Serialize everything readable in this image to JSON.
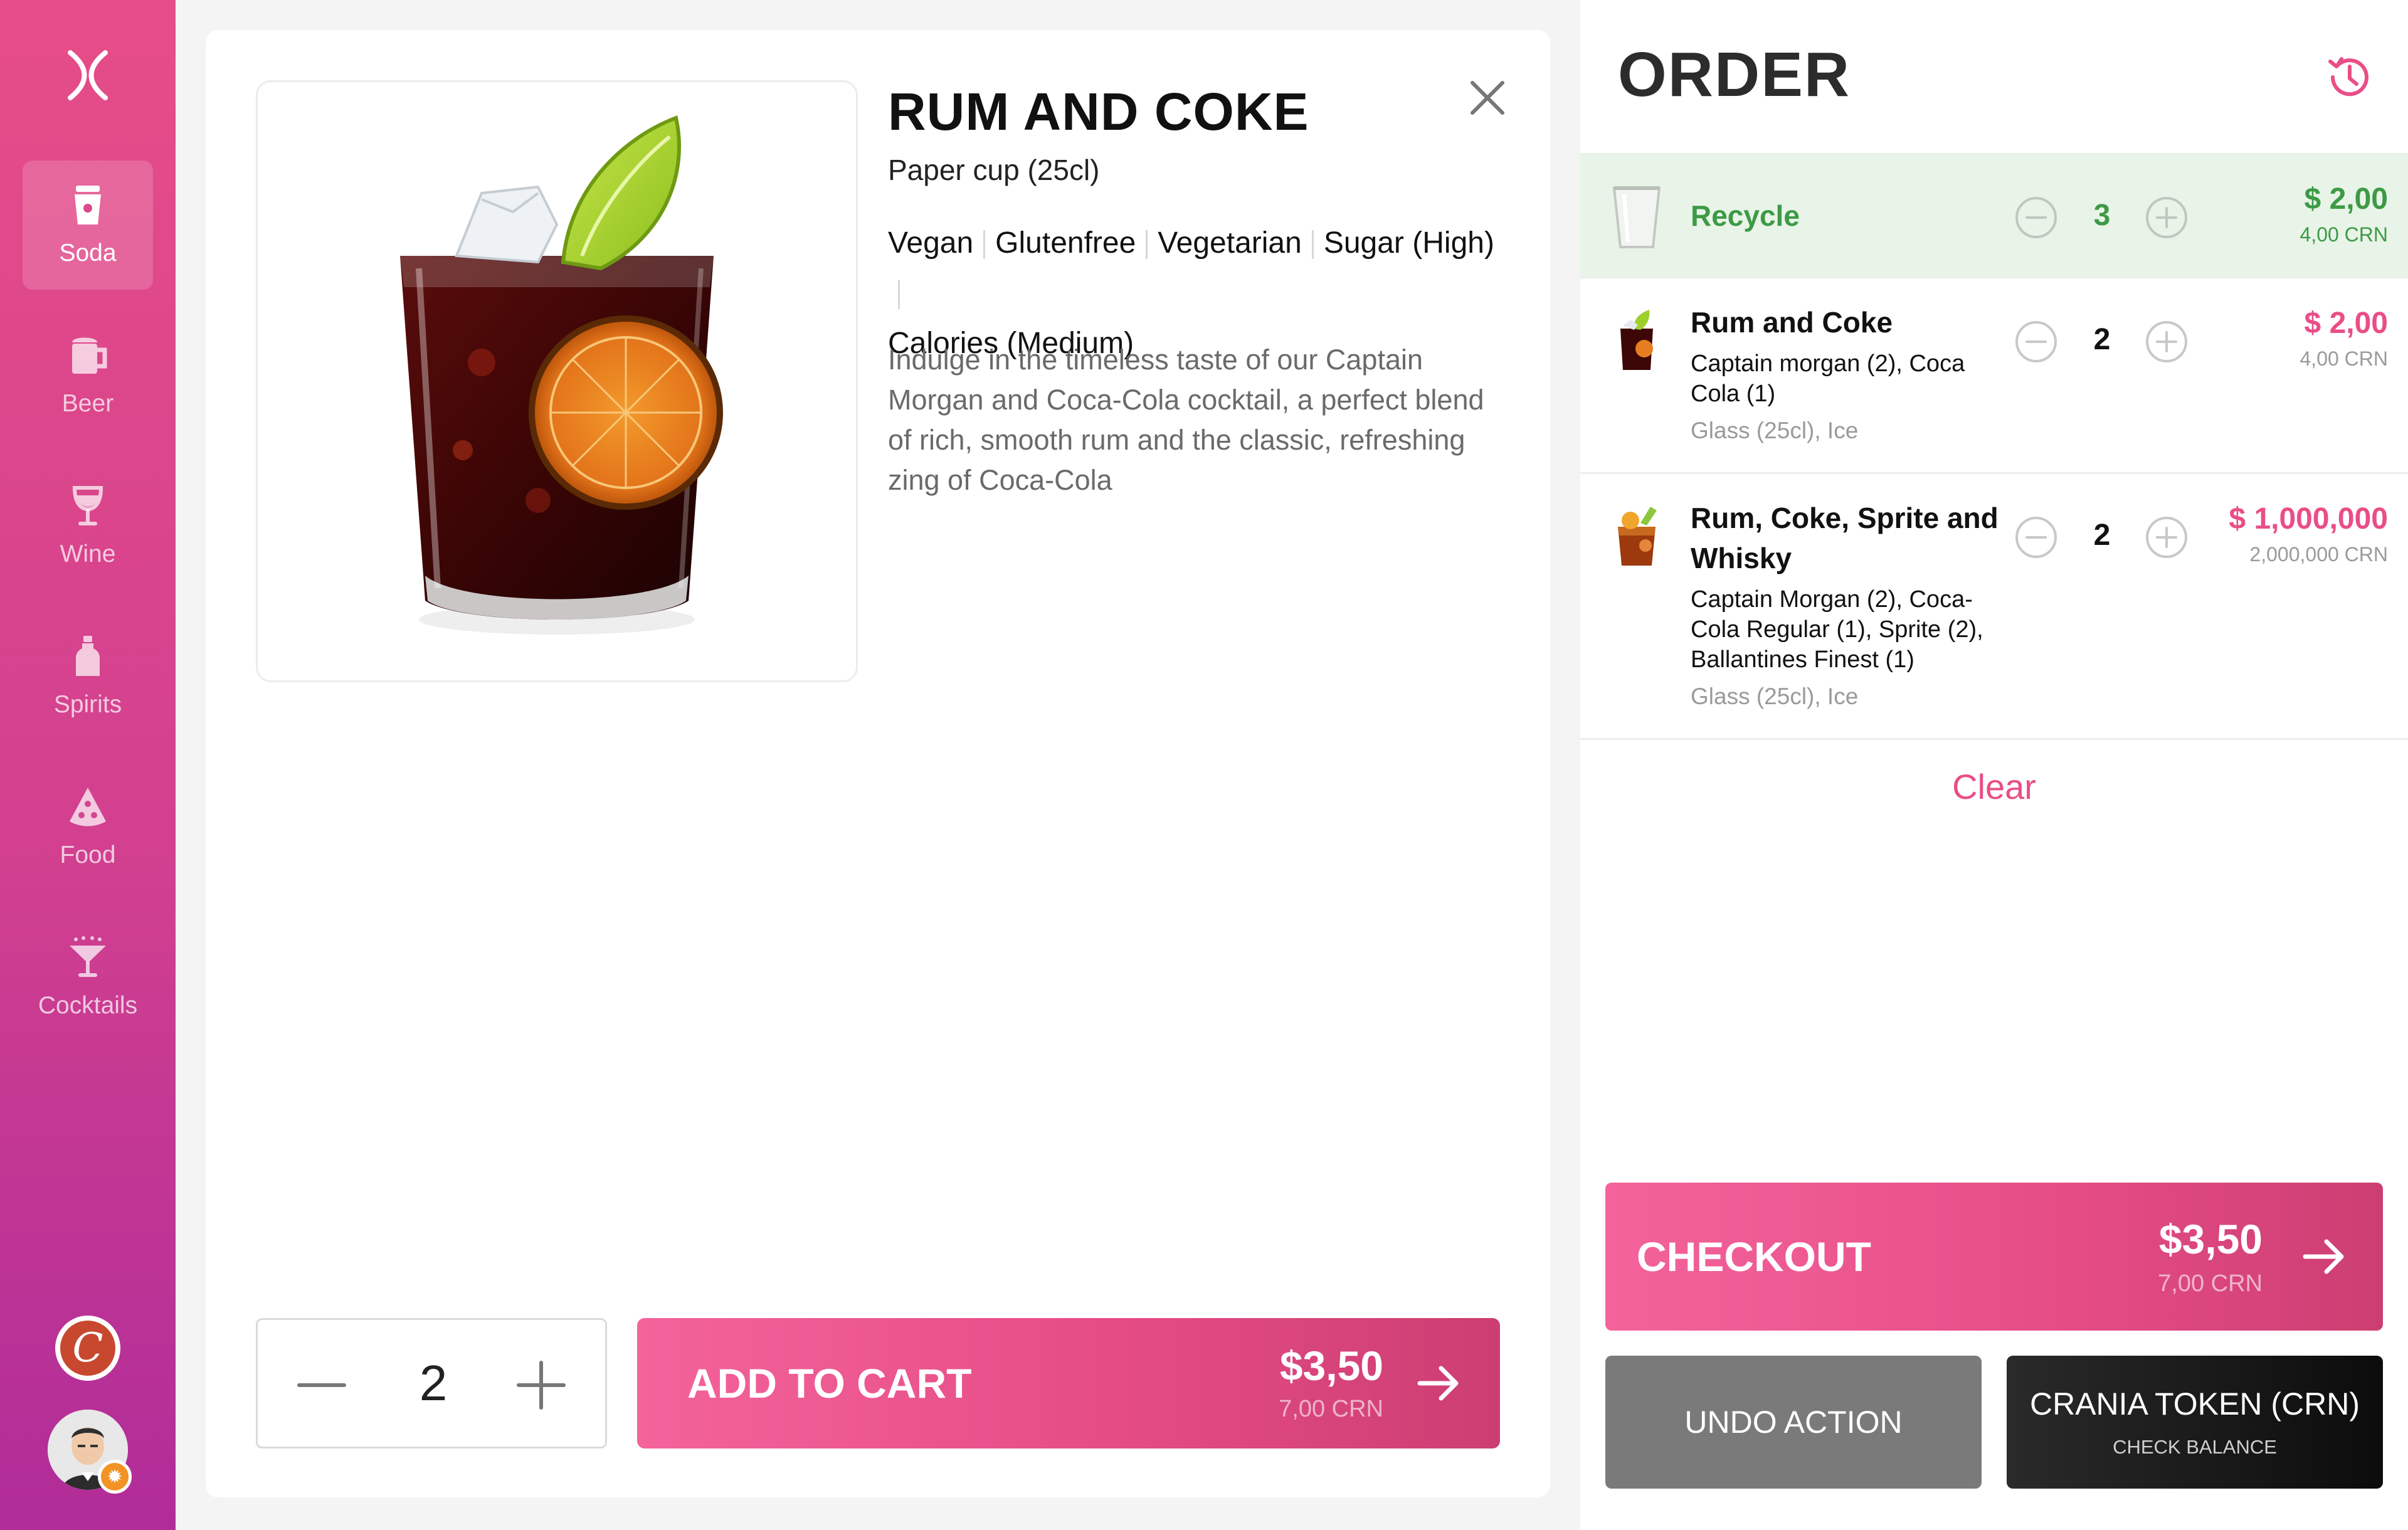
{
  "sidebar": {
    "logo": "x-logo-icon",
    "items": [
      {
        "label": "Soda",
        "icon": "soda-cup-icon",
        "active": true
      },
      {
        "label": "Beer",
        "icon": "beer-mug-icon",
        "active": false
      },
      {
        "label": "Wine",
        "icon": "wine-glass-icon",
        "active": false
      },
      {
        "label": "Spirits",
        "icon": "bottle-icon",
        "active": false
      },
      {
        "label": "Food",
        "icon": "pizza-slice-icon",
        "active": false
      },
      {
        "label": "Cocktails",
        "icon": "cocktail-glass-icon",
        "active": false
      }
    ],
    "brand_badge": "C",
    "accent": "#e64d88"
  },
  "product": {
    "title": "RUM AND COKE",
    "subtitle": "Paper cup (25cl)",
    "tags": [
      "Vegan",
      "Glutenfree",
      "Vegetarian",
      "Sugar (High)",
      "Calories (Medium)"
    ],
    "description": "Indulge in the timeless taste of our Captain Morgan and Coca-Cola cocktail, a perfect blend of rich, smooth rum and the classic, refreshing zing of Coca-Cola",
    "quantity": "2",
    "add_label": "ADD TO CART",
    "price": "$3,50",
    "price_crn": "7,00 CRN"
  },
  "order": {
    "title": "ORDER",
    "items": [
      {
        "name": "Recycle",
        "quantity": "3",
        "amount": "$ 2,00",
        "amount_crn": "4,00 CRN",
        "extras": "",
        "options": ""
      },
      {
        "name": "Rum and Coke",
        "quantity": "2",
        "amount": "$ 2,00",
        "amount_crn": "4,00 CRN",
        "extras": "Captain morgan (2), Coca Cola (1)",
        "options": "Glass (25cl), Ice"
      },
      {
        "name": "Rum, Coke, Sprite and Whisky",
        "quantity": "2",
        "amount": "$ 1,000,000",
        "amount_crn": "2,000,000 CRN",
        "extras": "Captain Morgan (2), Coca-Cola Regular (1), Sprite (2), Ballantines Finest (1)",
        "options": "Glass (25cl), Ice"
      }
    ],
    "clear_label": "Clear",
    "checkout_label": "CHECKOUT",
    "checkout_price": "$3,50",
    "checkout_crn": "7,00 CRN",
    "undo_label": "UNDO ACTION",
    "token_label": "CRANIA TOKEN (CRN)",
    "token_sub": "CHECK BALANCE"
  },
  "colors": {
    "pink": "#e94e86",
    "green": "#3d9a45",
    "recycle_bg": "#e8f4e8"
  }
}
